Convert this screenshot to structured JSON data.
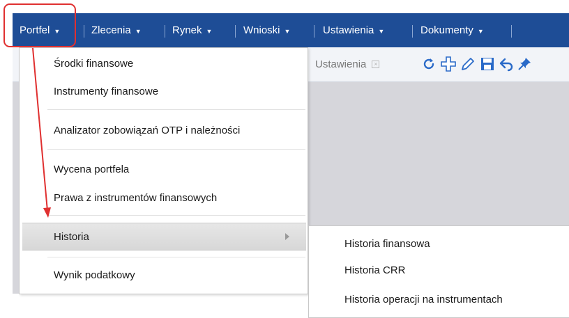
{
  "menubar": {
    "items": [
      {
        "label": "Portfel"
      },
      {
        "label": "Zlecenia"
      },
      {
        "label": "Rynek"
      },
      {
        "label": "Wnioski"
      },
      {
        "label": "Ustawienia"
      },
      {
        "label": "Dokumenty"
      }
    ],
    "caret": "▼"
  },
  "toolbar": {
    "tab_label": "Ustawienia",
    "tab_close": "×",
    "icons": [
      "refresh-icon",
      "add-icon",
      "edit-icon",
      "save-icon",
      "undo-icon",
      "pin-icon"
    ]
  },
  "dropdown": {
    "items": [
      {
        "label": "Środki finansowe"
      },
      {
        "label": "Instrumenty finansowe"
      },
      {
        "label": "Analizator zobowiązań OTP i należności"
      },
      {
        "label": "Wycena portfela"
      },
      {
        "label": "Prawa z instrumentów finansowych"
      },
      {
        "label": "Historia"
      },
      {
        "label": "Wynik podatkowy"
      }
    ]
  },
  "submenu": {
    "items": [
      {
        "label": "Historia finansowa"
      },
      {
        "label": "Historia CRR"
      },
      {
        "label": "Historia operacji na instrumentach"
      }
    ]
  },
  "colors": {
    "menubar_bg": "#1e4d96",
    "annotation": "#e03030",
    "workspace_bg": "#d6d6db",
    "icon_blue": "#2a6ac8"
  }
}
